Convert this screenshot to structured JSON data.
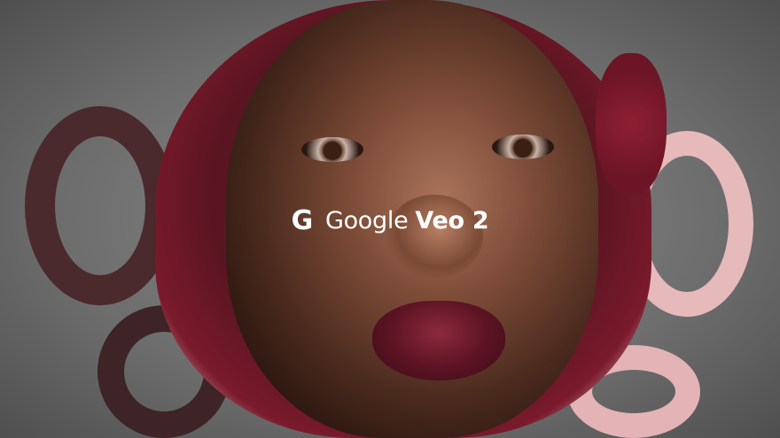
{
  "logo": {
    "icon": "google-g-icon",
    "icon_glyph": "G",
    "brand": "Google",
    "product": "Veo 2",
    "color": "#ffffff"
  },
  "colors": {
    "background": "#6f6f6f",
    "crochet_dark_red": "#7a1a2c",
    "crochet_pink": "#e8c3c3",
    "crochet_brown": "#4a2a2c"
  }
}
